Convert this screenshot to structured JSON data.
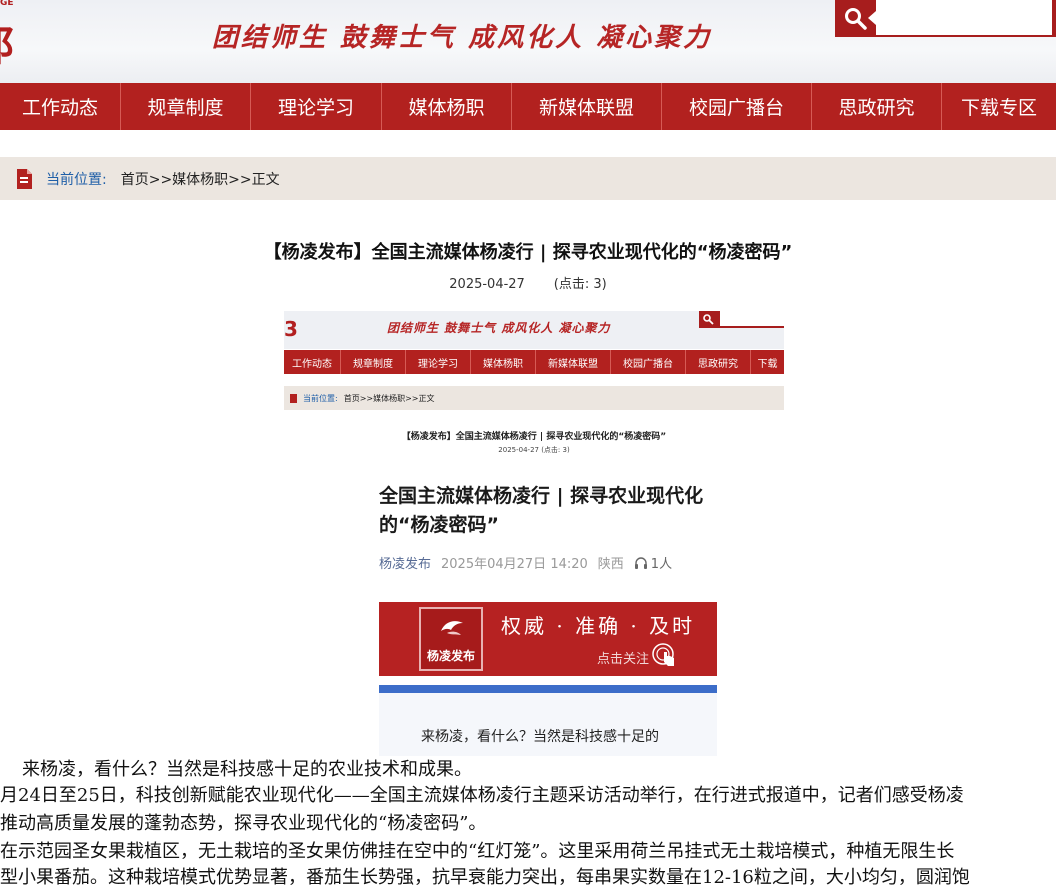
{
  "header": {
    "logo_fragment_top": "GE",
    "logo_fragment_mark": "阝",
    "slogan": "团结师生 鼓舞士气 成风化人 凝心聚力",
    "search": {
      "value": "",
      "placeholder": ""
    },
    "colors": {
      "brand_red": "#b2211f",
      "search_red": "#a71d1d"
    }
  },
  "nav": {
    "items": [
      "工作动态",
      "规章制度",
      "理论学习",
      "媒体杨职",
      "新媒体联盟",
      "校园广播台",
      "思政研究",
      "下载专区"
    ]
  },
  "location": {
    "label": "当前位置:",
    "path": "首页>>媒体杨职>>正文"
  },
  "article": {
    "title": "【杨凌发布】全国主流媒体杨凌行 | 探寻农业现代化的“杨凌密码”",
    "date": "2025-04-27",
    "clicks": "(点击: 3)"
  },
  "embedded_shot": {
    "logo_mark": "3",
    "slogan": "团结师生 鼓舞士气 成风化人 凝心聚力",
    "nav": [
      "工作动态",
      "规章制度",
      "理论学习",
      "媒体杨职",
      "新媒体联盟",
      "校园广播台",
      "思政研究",
      "下载"
    ],
    "location_label": "当前位置:",
    "location_path": "首页>>媒体杨职>>正文",
    "title": "【杨凌发布】全国主流媒体杨凌行 | 探寻农业现代化的“杨凌密码”",
    "meta": "2025-04-27    (点击: 3)"
  },
  "wechat_card": {
    "title": "全国主流媒体杨凌行 | 探寻农业现代化的“杨凌密码”",
    "source": "杨凌发布",
    "datetime": "2025年04月27日 14:20",
    "region": "陕西",
    "listeners": "1人",
    "promo_logo_text": "杨凌发布",
    "promo_tagline": "权威 · 准确 · 及时",
    "promo_follow": "点击关注",
    "first_line": "来杨凌，看什么？当然是科技感十足的"
  },
  "body": {
    "p1": "来杨凌，看什么？当然是科技感十足的农业技术和成果。",
    "p2a": "月24日至25日，科技创新赋能农业现代化——全国主流媒体杨凌行主题采访活动举行，在行进式报道中，记者们感受杨凌",
    "p2b": "推动高质量发展的蓬勃态势，探寻农业现代化的“杨凌密码”。",
    "p3a": "在示范园圣女果栽植区，无土栽培的圣女果仿佛挂在空中的“红灯笼”。这里采用荷兰吊挂式无土栽培模式，种植无限生长",
    "p3b": "型小果番茄。这种栽培模式优势显著，番茄生长势强，抗早衰能力突出，每串果实数量在12-16粒之间，大小均匀，圆润饱"
  }
}
